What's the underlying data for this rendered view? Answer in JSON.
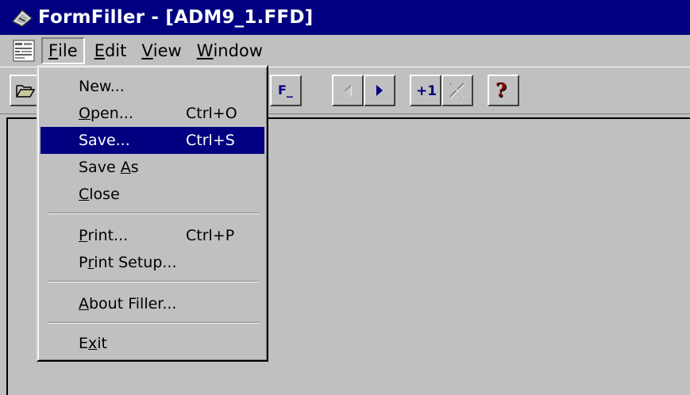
{
  "window": {
    "title": "FormFiller - [ADM9_1.FFD]",
    "title_icon": "formfiller-app-icon"
  },
  "menubar": {
    "system_icon": "document-system-menu-icon",
    "items": [
      {
        "label": "File",
        "accel": "F",
        "rest": "ile"
      },
      {
        "label": "Edit",
        "accel": "E",
        "rest": "dit"
      },
      {
        "label": "View",
        "accel": "V",
        "rest": "iew"
      },
      {
        "label": "Window",
        "accel": "W",
        "rest": "indow"
      }
    ]
  },
  "toolbar": {
    "buttons": [
      {
        "icon": "open-folder-icon"
      },
      {
        "icon": "field-f-icon",
        "text": "F_"
      },
      {
        "icon": "arrow-left-icon"
      },
      {
        "icon": "arrow-right-icon"
      },
      {
        "icon": "add-record-icon",
        "text": "+1"
      },
      {
        "icon": "delete-x-icon"
      },
      {
        "icon": "help-question-icon",
        "text": "?"
      }
    ]
  },
  "file_menu": {
    "items": [
      {
        "label": "New...",
        "pre": "",
        "accel": "",
        "post": "New...",
        "shortcut": ""
      },
      {
        "label": "Open...",
        "pre": "",
        "accel": "O",
        "post": "pen...",
        "shortcut": "Ctrl+O"
      },
      {
        "label": "Save...",
        "pre": "",
        "accel": "",
        "post": "Save...",
        "shortcut": "Ctrl+S",
        "selected": true
      },
      {
        "label": "Save As",
        "pre": "Save ",
        "accel": "A",
        "post": "s",
        "shortcut": ""
      },
      {
        "label": "Close",
        "pre": "",
        "accel": "C",
        "post": "lose",
        "shortcut": ""
      },
      {
        "label": "Print...",
        "pre": "",
        "accel": "P",
        "post": "rint...",
        "shortcut": "Ctrl+P"
      },
      {
        "label": "Print Setup...",
        "pre": "P",
        "accel": "r",
        "post": "int Setup...",
        "shortcut": ""
      },
      {
        "label": "About Filler...",
        "pre": "",
        "accel": "A",
        "post": "bout Filler...",
        "shortcut": ""
      },
      {
        "label": "Exit",
        "pre": "E",
        "accel": "x",
        "post": "it",
        "shortcut": ""
      }
    ]
  },
  "colors": {
    "titlebar": "#000080",
    "selection": "#000080",
    "face": "#c0c0c0"
  }
}
